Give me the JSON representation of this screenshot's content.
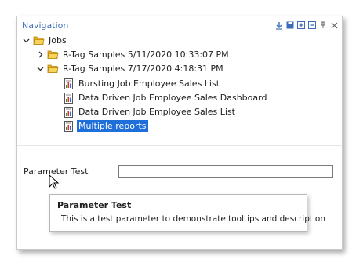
{
  "window": {
    "title": "Navigation"
  },
  "titlebar_icons": [
    "pin-down-icon",
    "save-icon",
    "expand-all-icon",
    "collapse-all-icon",
    "pin-icon",
    "close-icon"
  ],
  "tree": {
    "root": {
      "label": "Jobs",
      "expanded": true
    },
    "groups": [
      {
        "label": "R-Tag Samples 5/11/2020 10:33:07 PM",
        "expanded": false
      },
      {
        "label": "R-Tag Samples 7/17/2020 4:18:31 PM",
        "expanded": true
      }
    ],
    "reports": [
      {
        "label": "Bursting Job Employee Sales List",
        "selected": false
      },
      {
        "label": "Data Driven Job Employee Sales Dashboard",
        "selected": false
      },
      {
        "label": "Data Driven Job Employee Sales List",
        "selected": false
      },
      {
        "label": "Multiple reports",
        "selected": true
      }
    ]
  },
  "parameter": {
    "label": "Parameter Test",
    "value": ""
  },
  "tooltip": {
    "title": "Parameter Test",
    "body": "This is a test parameter to demonstrate tooltips and description"
  },
  "colors": {
    "title": "#3e6db5",
    "selection": "#1e6fd9",
    "folder": "#f2c230"
  }
}
